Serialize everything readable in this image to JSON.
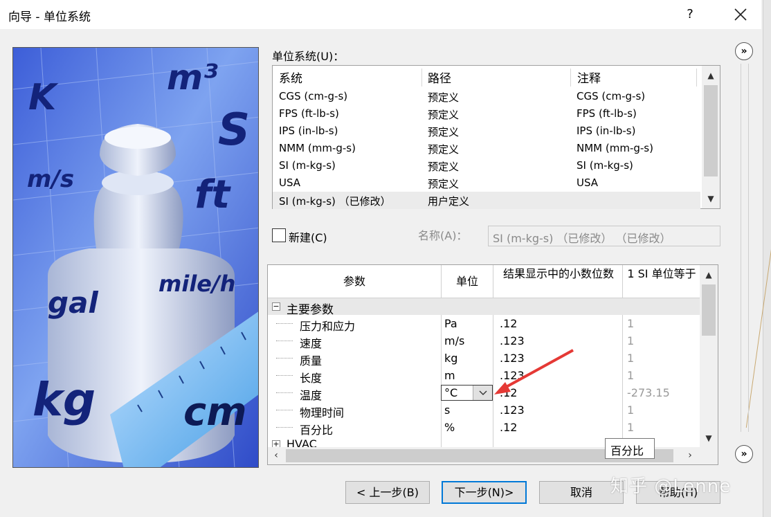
{
  "window": {
    "title": "向导 - 单位系统",
    "help_label": "?"
  },
  "deco_units": [
    "K",
    "m³",
    "S",
    "m/s",
    "ft",
    "mile/h",
    "gal",
    "kg",
    "cm"
  ],
  "units_system": {
    "label": "单位系统(U)：",
    "columns": [
      "系统",
      "路径",
      "注释"
    ],
    "rows": [
      [
        "CGS (cm-g-s)",
        "预定义",
        "CGS (cm-g-s)"
      ],
      [
        "FPS (ft-lb-s)",
        "预定义",
        "FPS (ft-lb-s)"
      ],
      [
        "IPS (in-lb-s)",
        "预定义",
        "IPS (in-lb-s)"
      ],
      [
        "NMM (mm-g-s)",
        "预定义",
        "NMM (mm-g-s)"
      ],
      [
        "SI (m-kg-s)",
        "预定义",
        "SI (m-kg-s)"
      ],
      [
        "USA",
        "预定义",
        "USA"
      ],
      [
        "SI (m-kg-s) （已修改）",
        "用户定义",
        ""
      ]
    ],
    "selected_row": 6
  },
  "new_checkbox": {
    "label": "新建(C)",
    "checked": false
  },
  "name_field": {
    "label": "名称(A)：",
    "value": "SI (m-kg-s) （已修改） （已修改）"
  },
  "params_grid": {
    "columns": [
      "参数",
      "单位",
      "结果显示中的小数位数",
      "1 SI 单位等于"
    ],
    "group_main": "主要参数",
    "rows": [
      [
        "压力和应力",
        "Pa",
        ".12",
        "1"
      ],
      [
        "速度",
        "m/s",
        ".123",
        "1"
      ],
      [
        "质量",
        "kg",
        ".123",
        "1"
      ],
      [
        "长度",
        "m",
        ".123",
        "1"
      ],
      [
        "温度",
        "°C",
        ".12",
        "-273.15"
      ],
      [
        "物理时间",
        "s",
        ".123",
        "1"
      ],
      [
        "百分比",
        "%",
        ".12",
        "1"
      ]
    ],
    "group_hvac": "HVAC"
  },
  "tooltip": "百分比",
  "buttons": {
    "back": "< 上一步(B)",
    "next": "下一步(N)>",
    "cancel": "取消",
    "help": "帮助(H)"
  },
  "watermark": "知乎 @Lenne",
  "colors": {
    "accent": "#0078d7",
    "arrow": "#e53935"
  }
}
